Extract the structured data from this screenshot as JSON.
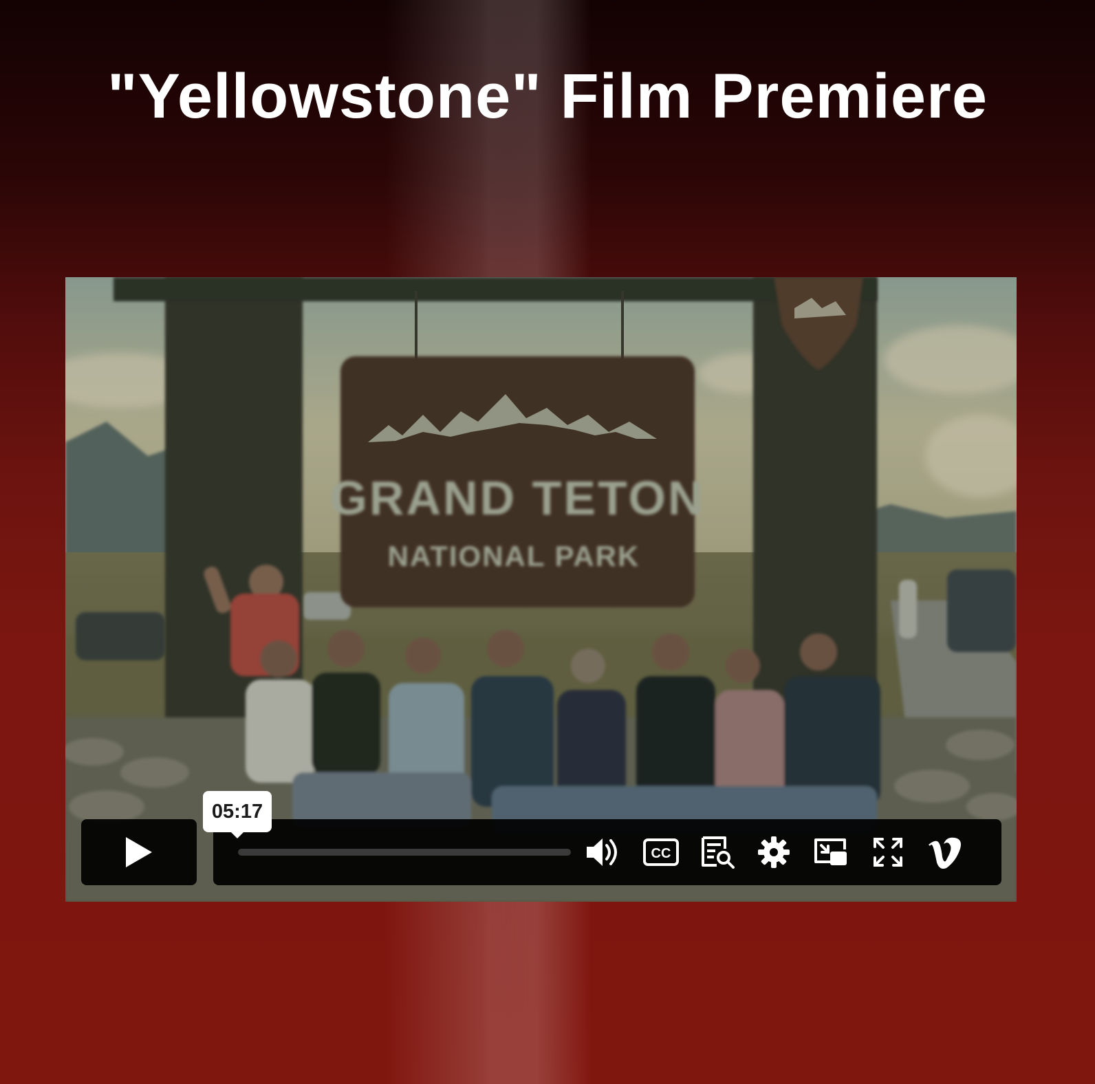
{
  "page": {
    "title": "\"Yellowstone\" Film Premiere"
  },
  "video": {
    "sign": {
      "line1": "GRAND TETON",
      "line2": "NATIONAL PARK"
    },
    "controls": {
      "play_icon": "play-icon",
      "timecode": "05:17",
      "progress_fraction": 0.0,
      "icons": [
        "volume-icon",
        "closed-captions-icon",
        "transcript-search-icon",
        "settings-gear-icon",
        "picture-in-picture-icon",
        "fullscreen-icon",
        "vimeo-logo"
      ],
      "captions_label": "CC"
    }
  },
  "colors": {
    "background_top": "#130203",
    "background_bottom": "#80170f",
    "control_bg": "#000000",
    "icon": "#ffffff"
  }
}
